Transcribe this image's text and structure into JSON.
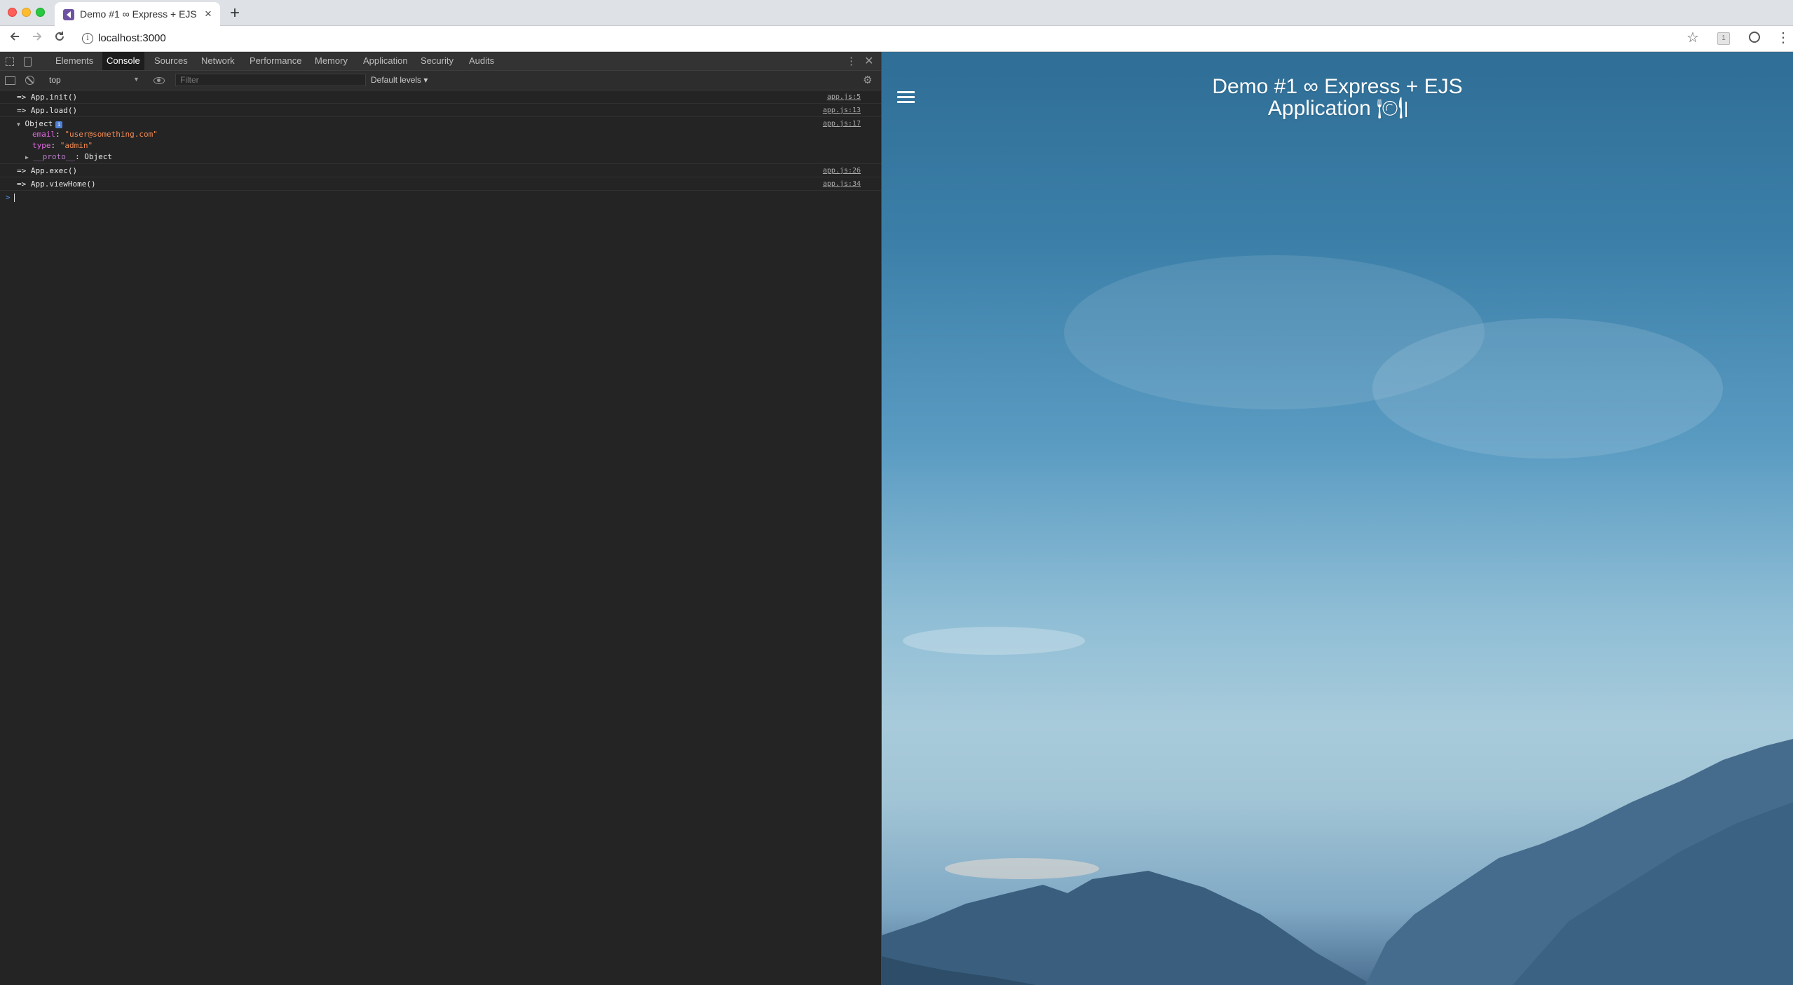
{
  "browser": {
    "tab_title": "Demo #1 ∞ Express + EJS App",
    "tab_close": "×",
    "new_tab": "+",
    "url": "localhost:3000",
    "icons": {
      "back": "arrow-left",
      "forward": "arrow-right",
      "reload": "reload",
      "info": "i",
      "bookmark": "☆",
      "extension": "1",
      "profile": "profile",
      "menu": "⋮"
    }
  },
  "devtools": {
    "tabs": [
      {
        "label": "Elements",
        "active": false
      },
      {
        "label": "Console",
        "active": true
      },
      {
        "label": "Sources",
        "active": false
      },
      {
        "label": "Network",
        "active": false
      },
      {
        "label": "Performance",
        "active": false
      },
      {
        "label": "Memory",
        "active": false
      },
      {
        "label": "Application",
        "active": false
      },
      {
        "label": "Security",
        "active": false
      },
      {
        "label": "Audits",
        "active": false
      }
    ],
    "more_icon": "⋮",
    "close_icon": "✕",
    "filterbar": {
      "context": "top",
      "filter_placeholder": "Filter",
      "levels": "Default levels ▾",
      "context_caret": "▼",
      "settings_icon": "⚙"
    },
    "console": {
      "logs": [
        {
          "text": "=> App.init()",
          "source": "app.js:5"
        },
        {
          "text": "=> App.load()",
          "source": "app.js:13"
        }
      ],
      "object": {
        "label": "Object",
        "badge": "i",
        "source": "app.js:17",
        "arrow": "▼",
        "props": [
          {
            "key": "email",
            "sep": ": ",
            "value": "\"user@something.com\""
          },
          {
            "key": "type",
            "sep": ": ",
            "value": "\"admin\""
          }
        ],
        "proto_arrow": "▶",
        "proto_key": "__proto__",
        "proto_value": ": Object"
      },
      "logs_after": [
        {
          "text": "=> App.exec()",
          "source": "app.js:26"
        },
        {
          "text": "=> App.viewHome()",
          "source": "app.js:34"
        }
      ],
      "prompt": ">"
    }
  },
  "page": {
    "title_line1": "Demo #1 ∞ Express + EJS",
    "title_line2": "Application 🍽",
    "menu_icon": "hamburger-menu"
  },
  "colors": {
    "devtools_bg": "#242424",
    "console_string": "#f28b54",
    "console_key": "#e36ae3",
    "sky_top": "#2f6e96",
    "sky_horizon": "#a8cbdb"
  }
}
